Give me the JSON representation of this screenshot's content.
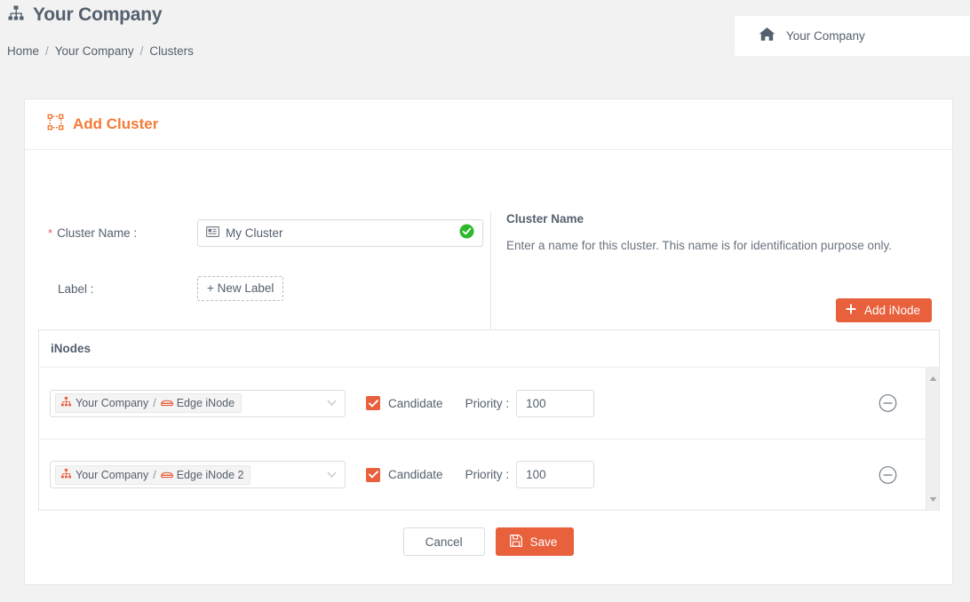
{
  "header": {
    "brand_title": "Your Company",
    "brand_icon": "sitemap-icon",
    "breadcrumb": [
      {
        "label": "Home"
      },
      {
        "label": "Your Company"
      },
      {
        "label": "Clusters"
      }
    ],
    "breadcrumb_separator": "/",
    "company_panel": {
      "icon": "home-icon",
      "label": "Your Company"
    }
  },
  "card": {
    "title": "Add Cluster",
    "title_icon": "cluster-select-icon",
    "form": {
      "cluster_name": {
        "required_marker": "*",
        "label": "Cluster Name :",
        "value": "My Cluster",
        "placeholder": "Cluster Name",
        "prefix_icon": "id-card-icon",
        "status_icon": "valid-check-icon"
      },
      "label_field": {
        "label": "Label :",
        "button_text": "+ New Label"
      }
    },
    "help": {
      "title": "Cluster Name",
      "text": "Enter a name for this cluster. This name is for identification purpose only."
    },
    "add_inode_button": {
      "label": "Add iNode",
      "icon": "plus-icon"
    },
    "inodes_panel": {
      "title": "iNodes",
      "rows": [
        {
          "select_value_company": "Your Company",
          "select_separator": "/",
          "select_value_node": "Edge iNode",
          "company_icon": "sitemap-icon",
          "node_icon": "server-icon",
          "caret_icon": "chevron-down-icon",
          "candidate_label": "Candidate",
          "candidate_checked": true,
          "priority_label": "Priority :",
          "priority_value": "100",
          "remove_icon": "minus-circle-icon"
        },
        {
          "select_value_company": "Your Company",
          "select_separator": "/",
          "select_value_node": "Edge iNode 2",
          "company_icon": "sitemap-icon",
          "node_icon": "server-icon",
          "caret_icon": "chevron-down-icon",
          "candidate_label": "Candidate",
          "candidate_checked": true,
          "priority_label": "Priority :",
          "priority_value": "100",
          "remove_icon": "minus-circle-icon"
        }
      ],
      "scrollbar": {
        "up_icon": "scroll-up-arrow-icon",
        "down_icon": "scroll-down-arrow-icon"
      }
    },
    "footer": {
      "cancel_label": "Cancel",
      "save_label": "Save",
      "save_icon": "floppy-save-icon"
    }
  },
  "colors": {
    "accent_orange": "#e8603c",
    "title_orange": "#f47b35",
    "valid_green": "#2eb82e",
    "required_red": "#f05b5b",
    "text": "#55606e",
    "page_bg": "#f2f2f2"
  }
}
